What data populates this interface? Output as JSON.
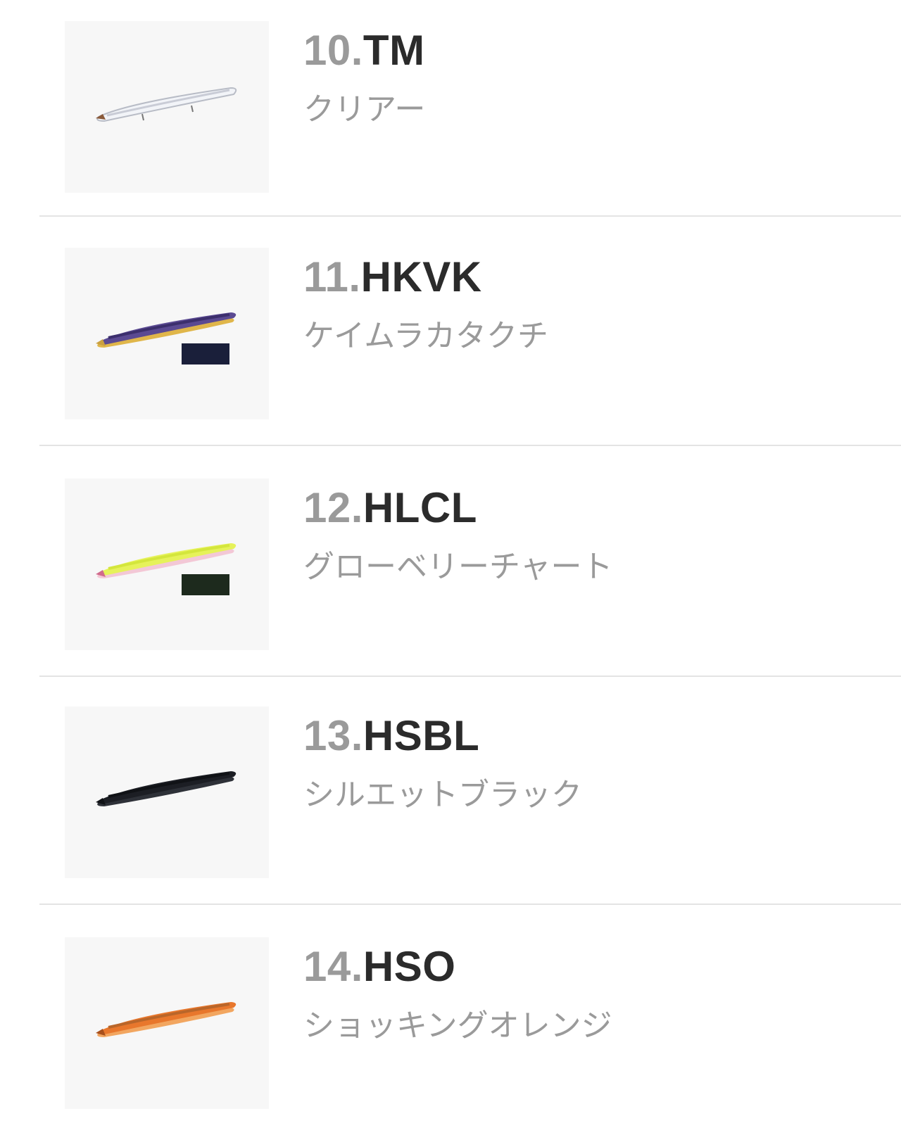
{
  "items": [
    {
      "num": "10.",
      "code": "TM",
      "name": "クリアー",
      "body_color": "#f2f4f8",
      "belly_color": "#d8dde6",
      "back_color": "#c9ccd6",
      "tag": false,
      "tag_color": ""
    },
    {
      "num": "11.",
      "code": "HKVK",
      "name": "ケイムラカタクチ",
      "body_color": "#5b4a92",
      "belly_color": "#e0b64a",
      "back_color": "#3c2f6d",
      "tag": true,
      "tag_color": "#1a1f3a"
    },
    {
      "num": "12.",
      "code": "HLCL",
      "name": "グローベリーチャート",
      "body_color": "#e6f25a",
      "belly_color": "#f3c8d6",
      "back_color": "#d4e63c",
      "tag": true,
      "tag_color": "#1d2a1d"
    },
    {
      "num": "13.",
      "code": "HSBL",
      "name": "シルエットブラック",
      "body_color": "#1c1e24",
      "belly_color": "#2e3138",
      "back_color": "#101216",
      "tag": false,
      "tag_color": ""
    },
    {
      "num": "14.",
      "code": "HSO",
      "name": "ショッキングオレンジ",
      "body_color": "#e8772c",
      "belly_color": "#f2a660",
      "back_color": "#b9662a",
      "tag": false,
      "tag_color": ""
    }
  ]
}
